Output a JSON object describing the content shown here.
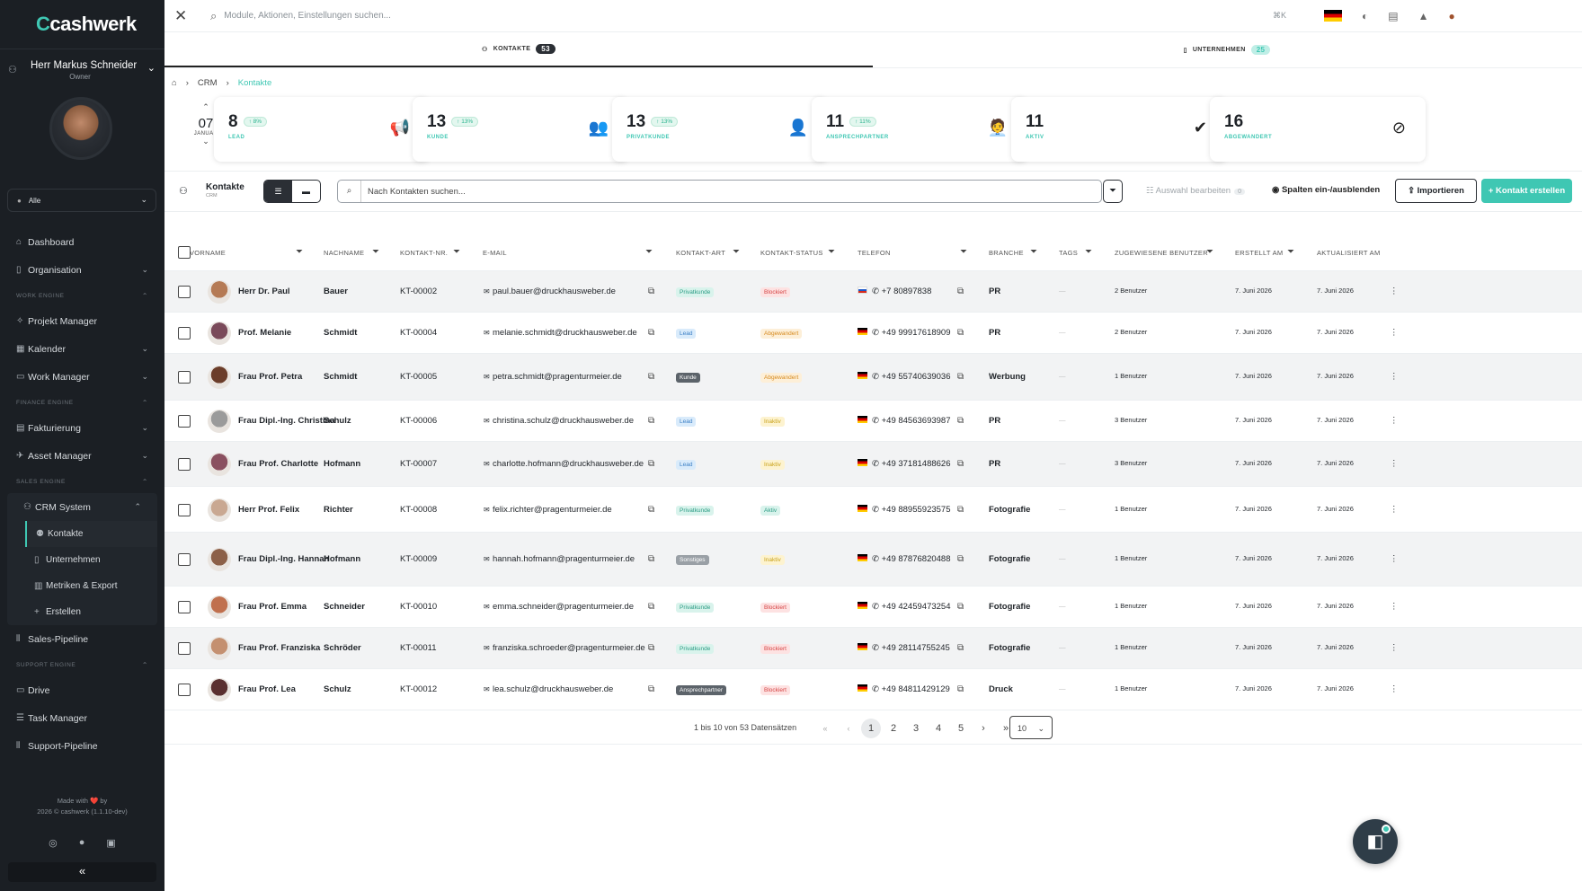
{
  "sidebar": {
    "logo": "cashwerk",
    "user_name": "Herr Markus Schneider",
    "user_role": "Owner",
    "selector": "Alle",
    "nav": [
      {
        "type": "item",
        "label": "Dashboard",
        "icon": "home-icon"
      },
      {
        "type": "item",
        "label": "Organisation",
        "icon": "building-icon",
        "chev": "⌄"
      },
      {
        "type": "sec",
        "label": "WORK ENGINE"
      },
      {
        "type": "item",
        "label": "Projekt Manager",
        "icon": "project-icon"
      },
      {
        "type": "item",
        "label": "Kalender",
        "icon": "calendar-icon",
        "chev": "⌄"
      },
      {
        "type": "item",
        "label": "Work Manager",
        "icon": "briefcase-icon",
        "chev": "⌄"
      },
      {
        "type": "sec",
        "label": "FINANCE ENGINE"
      },
      {
        "type": "item",
        "label": "Fakturierung",
        "icon": "invoice-icon",
        "chev": "⌄"
      },
      {
        "type": "item",
        "label": "Asset Manager",
        "icon": "asset-icon",
        "chev": "⌄"
      },
      {
        "type": "sec",
        "label": "SALES ENGINE"
      },
      {
        "type": "item",
        "label": "CRM System",
        "icon": "users-icon",
        "chev": "⌃",
        "crm": true
      },
      {
        "type": "sub",
        "label": "Kontakte",
        "icon": "contacts-icon",
        "active": true
      },
      {
        "type": "sub",
        "label": "Unternehmen",
        "icon": "building-icon"
      },
      {
        "type": "sub",
        "label": "Metriken & Export",
        "icon": "chart-icon"
      },
      {
        "type": "sub",
        "label": "Erstellen",
        "icon": "plus-icon"
      },
      {
        "type": "item",
        "label": "Sales-Pipeline",
        "icon": "pipeline-icon"
      },
      {
        "type": "sec",
        "label": "SUPPORT ENGINE"
      },
      {
        "type": "item",
        "label": "Drive",
        "icon": "drive-icon"
      },
      {
        "type": "item",
        "label": "Task Manager",
        "icon": "tasks-icon"
      },
      {
        "type": "item",
        "label": "Support-Pipeline",
        "icon": "pipeline-icon"
      }
    ],
    "footer_line1": "Made with ❤️ by",
    "footer_line2": "2026 © cashwerk (1.1.10-dev)"
  },
  "topbar": {
    "search_placeholder": "Module, Aktionen, Einstellungen suchen...",
    "shortcut": "⌘K"
  },
  "tabs": [
    {
      "label": "KONTAKTE",
      "count": "53",
      "active": true
    },
    {
      "label": "UNTERNEHMEN",
      "count": "25",
      "active": false
    }
  ],
  "breadcrumb": {
    "crm": "CRM",
    "current": "Kontakte"
  },
  "date": {
    "day": "07",
    "month": "JANUAR"
  },
  "stats": [
    {
      "value": "8",
      "trend": "↑ 8%",
      "label": "LEAD",
      "icon": "📢"
    },
    {
      "value": "13",
      "trend": "↑ 13%",
      "label": "KUNDE",
      "icon": "👥"
    },
    {
      "value": "13",
      "trend": "↑ 13%",
      "label": "PRIVATKUNDE",
      "icon": "👤"
    },
    {
      "value": "11",
      "trend": "↑ 11%",
      "label": "ANSPRECHPARTNER",
      "icon": "🧑‍💼"
    },
    {
      "value": "11",
      "trend": "",
      "label": "AKTIV",
      "icon": "✔"
    },
    {
      "value": "16",
      "trend": "",
      "label": "ABGEWANDERT",
      "icon": "⊘"
    }
  ],
  "toolbar": {
    "title": "Kontakte",
    "subtitle": "CRM",
    "search_placeholder": "Nach Kontakten suchen...",
    "auswahl": "Auswahl bearbeiten",
    "auswahl_count": "0",
    "spalten": "Spalten ein-/ausblenden",
    "import": "Importieren",
    "create": "+ Kontakt erstellen"
  },
  "columns": [
    "VORNAME",
    "NACHNAME",
    "KONTAKT-NR.",
    "E-MAIL",
    "KONTAKT-ART",
    "KONTAKT-STATUS",
    "TELEFON",
    "BRANCHE",
    "TAGS",
    "ZUGEWIESENE BENUTZER",
    "ERSTELLT AM",
    "AKTUALISIERT AM"
  ],
  "rows": [
    {
      "vorname": "Herr Dr. Paul",
      "nachname": "Bauer",
      "nr": "KT-00002",
      "email": "paul.bauer@druckhausweber.de",
      "art": "Privatkunde",
      "artc": "t-priv",
      "status": "Blockiert",
      "sc": "s-blk",
      "flag": "fru",
      "tel": "+7 80897838",
      "branche": "PR",
      "tags": "—",
      "benutzer": "2 Benutzer",
      "erstellt": "7. Juni 2026",
      "aktualisiert": "7. Juni 2026",
      "av": "#b57a55"
    },
    {
      "vorname": "Prof. Melanie",
      "nachname": "Schmidt",
      "nr": "KT-00004",
      "email": "melanie.schmidt@druckhausweber.de",
      "art": "Lead",
      "artc": "t-lead",
      "status": "Abgewandert",
      "sc": "s-abg",
      "flag": "fde",
      "tel": "+49 99917618909",
      "branche": "PR",
      "tags": "—",
      "benutzer": "2 Benutzer",
      "erstellt": "7. Juni 2026",
      "aktualisiert": "7. Juni 2026",
      "av": "#7a4a5a"
    },
    {
      "vorname": "Frau Prof. Petra",
      "nachname": "Schmidt",
      "nr": "KT-00005",
      "email": "petra.schmidt@pragenturmeier.de",
      "art": "Kunde",
      "artc": "t-kunde",
      "status": "Abgewandert",
      "sc": "s-abg",
      "flag": "fde",
      "tel": "+49 55740639036",
      "branche": "Werbung",
      "tags": "—",
      "benutzer": "1 Benutzer",
      "erstellt": "7. Juni 2026",
      "aktualisiert": "7. Juni 2026",
      "av": "#6b3d2a"
    },
    {
      "vorname": "Frau Dipl.-Ing. Christina",
      "nachname": "Schulz",
      "nr": "KT-00006",
      "email": "christina.schulz@druckhausweber.de",
      "art": "Lead",
      "artc": "t-lead",
      "status": "Inaktiv",
      "sc": "s-ina",
      "flag": "fde",
      "tel": "+49 84563693987",
      "branche": "PR",
      "tags": "—",
      "benutzer": "3 Benutzer",
      "erstellt": "7. Juni 2026",
      "aktualisiert": "7. Juni 2026",
      "av": "#9b9b9b"
    },
    {
      "vorname": "Frau Prof. Charlotte",
      "nachname": "Hofmann",
      "nr": "KT-00007",
      "email": "charlotte.hofmann@druckhausweber.de",
      "art": "Lead",
      "artc": "t-lead",
      "status": "Inaktiv",
      "sc": "s-ina",
      "flag": "fde",
      "tel": "+49 37181488626",
      "branche": "PR",
      "tags": "—",
      "benutzer": "3 Benutzer",
      "erstellt": "7. Juni 2026",
      "aktualisiert": "7. Juni 2026",
      "av": "#8a5060"
    },
    {
      "vorname": "Herr Prof. Felix",
      "nachname": "Richter",
      "nr": "KT-00008",
      "email": "felix.richter@pragenturmeier.de",
      "art": "Privatkunde",
      "artc": "t-priv",
      "status": "Aktiv",
      "sc": "s-akt",
      "flag": "fde",
      "tel": "+49 88955923575",
      "branche": "Fotografie",
      "tags": "—",
      "benutzer": "1 Benutzer",
      "erstellt": "7. Juni 2026",
      "aktualisiert": "7. Juni 2026",
      "av": "#c9a892"
    },
    {
      "vorname": "Frau Dipl.-Ing. Hannah",
      "nachname": "Hofmann",
      "nr": "KT-00009",
      "email": "hannah.hofmann@pragenturmeier.de",
      "art": "Sonstiges",
      "artc": "t-sonst",
      "status": "Inaktiv",
      "sc": "s-ina",
      "flag": "fde",
      "tel": "+49 87876820488",
      "branche": "Fotografie",
      "tags": "—",
      "benutzer": "1 Benutzer",
      "erstellt": "7. Juni 2026",
      "aktualisiert": "7. Juni 2026",
      "av": "#8c6048"
    },
    {
      "vorname": "Frau Prof. Emma",
      "nachname": "Schneider",
      "nr": "KT-00010",
      "email": "emma.schneider@pragenturmeier.de",
      "art": "Privatkunde",
      "artc": "t-priv",
      "status": "Blockiert",
      "sc": "s-blk",
      "flag": "fde",
      "tel": "+49 42459473254",
      "branche": "Fotografie",
      "tags": "—",
      "benutzer": "1 Benutzer",
      "erstellt": "7. Juni 2026",
      "aktualisiert": "7. Juni 2026",
      "av": "#c0704e"
    },
    {
      "vorname": "Frau Prof. Franziska",
      "nachname": "Schröder",
      "nr": "KT-00011",
      "email": "franziska.schroeder@pragenturmeier.de",
      "art": "Privatkunde",
      "artc": "t-priv",
      "status": "Blockiert",
      "sc": "s-blk",
      "flag": "fde",
      "tel": "+49 28114755245",
      "branche": "Fotografie",
      "tags": "—",
      "benutzer": "1 Benutzer",
      "erstellt": "7. Juni 2026",
      "aktualisiert": "7. Juni 2026",
      "av": "#c49070"
    },
    {
      "vorname": "Frau Prof. Lea",
      "nachname": "Schulz",
      "nr": "KT-00012",
      "email": "lea.schulz@druckhausweber.de",
      "art": "Ansprechpartner",
      "artc": "t-ansp",
      "status": "Blockiert",
      "sc": "s-blk",
      "flag": "fde",
      "tel": "+49 84811429129",
      "branche": "Druck",
      "tags": "—",
      "benutzer": "1 Benutzer",
      "erstellt": "7. Juni 2026",
      "aktualisiert": "7. Juni 2026",
      "av": "#5a3030"
    }
  ],
  "pagination": {
    "info": "1 bis 10 von 53 Datensätzen",
    "first": "«",
    "prev": "‹",
    "pages": [
      "1",
      "2",
      "3",
      "4",
      "5"
    ],
    "next": "›",
    "last": "»",
    "per_page": "10"
  },
  "colors": {
    "accent": "#3fc7b3",
    "sidebar": "#1b1f24"
  }
}
